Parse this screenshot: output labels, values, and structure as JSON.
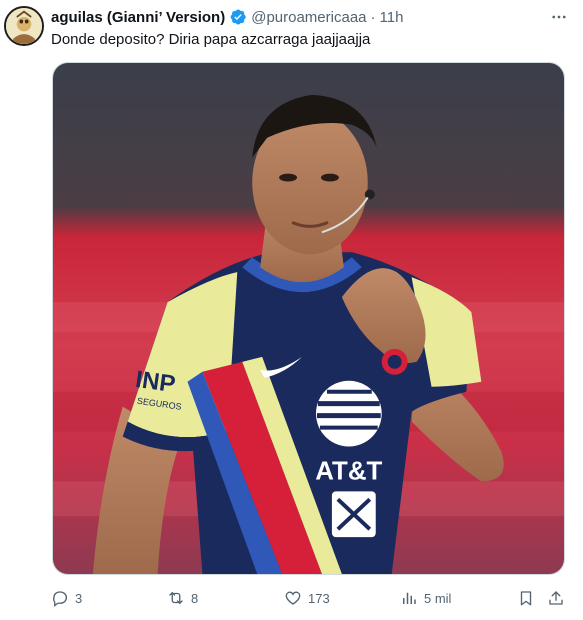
{
  "tweet": {
    "display_name": "aguilas (Gianni’ Version)",
    "handle": "@puroamericaaa",
    "separator": "·",
    "time": "11h",
    "text": "Donde deposito? Diria papa azcarraga jaajjaajja",
    "verified": true
  },
  "media": {
    "jersey_sponsor": "AT&T",
    "sleeve_sponsor": "INP",
    "sleeve_subtext": "SEGUROS"
  },
  "actions": {
    "replies": "3",
    "reposts": "8",
    "likes": "173",
    "views": "5 mil"
  },
  "colors": {
    "accent": "#1d9bf0",
    "text": "#0f1419",
    "muted": "#536471",
    "jersey_yellow": "#e9ea9a",
    "jersey_navy": "#1a2a5c",
    "stripe_red": "#d6203a"
  },
  "icons": [
    "more-icon",
    "verified-badge-icon",
    "reply-icon",
    "repost-icon",
    "like-icon",
    "views-icon",
    "bookmark-icon",
    "share-icon"
  ]
}
